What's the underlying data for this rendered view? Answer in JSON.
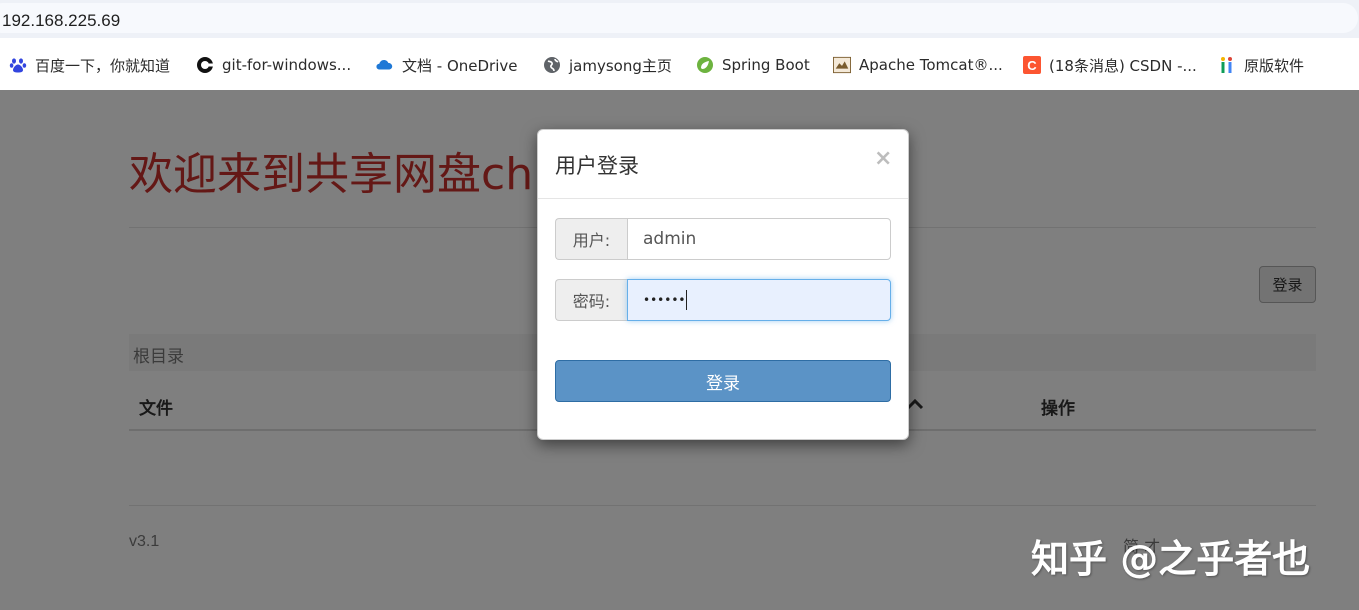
{
  "browser": {
    "url": "192.168.225.69",
    "bookmarks": [
      {
        "label": "百度一下，你就知道",
        "icon": "baidu-paw-icon"
      },
      {
        "label": "git-for-windows...",
        "icon": "git-logo-icon"
      },
      {
        "label": "文档 - OneDrive",
        "icon": "onedrive-cloud-icon"
      },
      {
        "label": "jamysong主页",
        "icon": "globe-icon"
      },
      {
        "label": "Spring Boot",
        "icon": "spring-leaf-icon"
      },
      {
        "label": "Apache Tomcat®...",
        "icon": "tomcat-logo-icon"
      },
      {
        "label": "(18条消息) CSDN -...",
        "icon": "csdn-logo-icon"
      },
      {
        "label": "原版软件",
        "icon": "colorful-i-icon"
      }
    ]
  },
  "page": {
    "welcome": "欢迎来到共享网盘ch",
    "login_button": "登录",
    "breadcrumb": "根目录",
    "table_headers": {
      "file": "文件",
      "operation": "操作"
    },
    "version": "v3.1",
    "footer_right": "简 才"
  },
  "modal": {
    "title": "用户登录",
    "close": "×",
    "user_label": "用户:",
    "user_value": "admin",
    "password_label": "密码:",
    "password_masked": "••••••",
    "submit": "登录"
  },
  "watermark": "知乎 @之乎者也",
  "colors": {
    "welcome_red": "#c9302c",
    "primary_button": "#5b93c6",
    "focus_border": "#66afe9"
  }
}
